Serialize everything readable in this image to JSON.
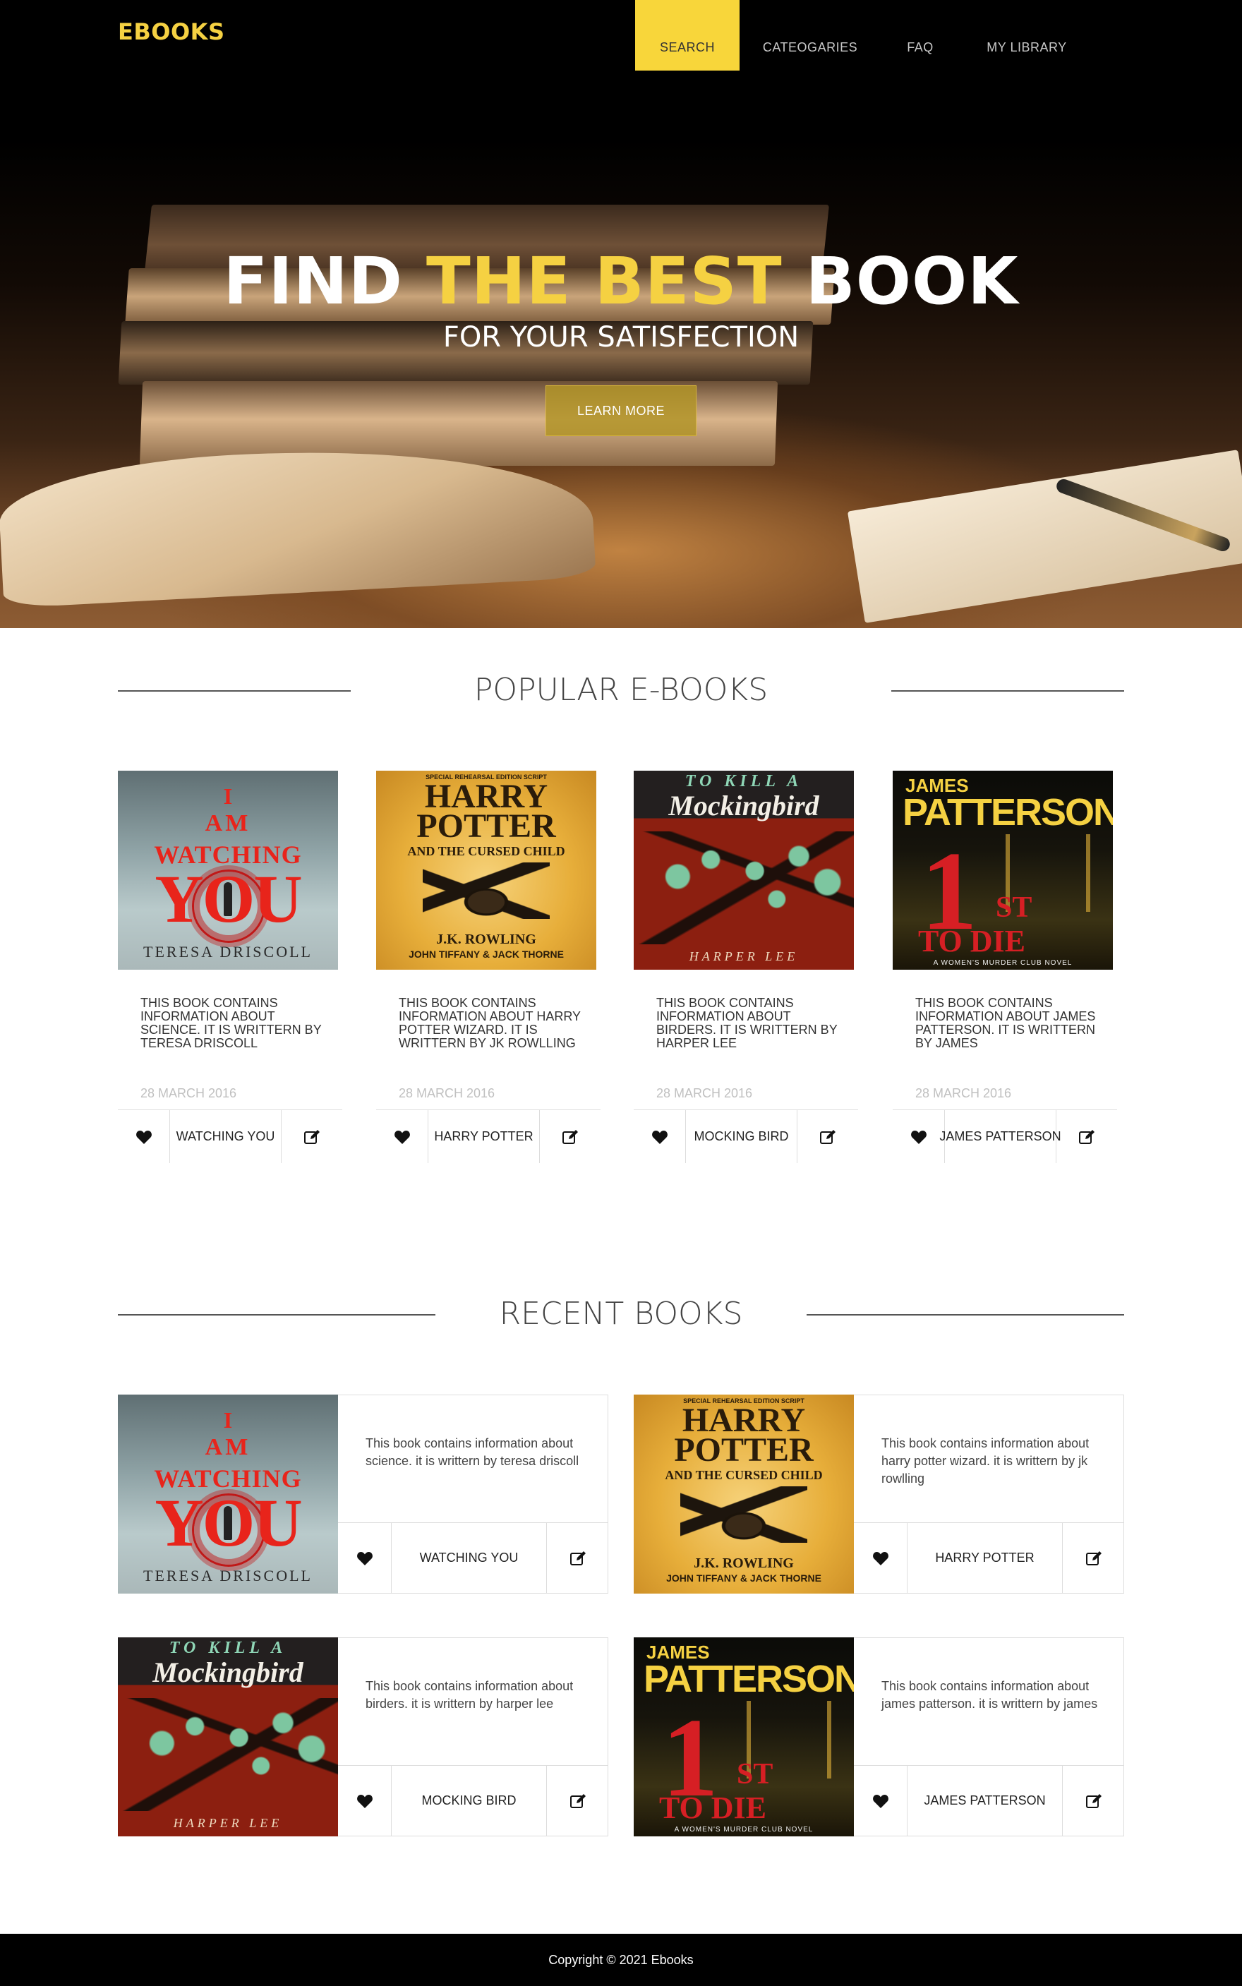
{
  "brand": "EBOOKS",
  "nav": {
    "search": "SEARCH",
    "categories": "CATEOGARIES",
    "faq": "FAQ",
    "library": "MY LIBRARY"
  },
  "hero": {
    "title_pre": "FIND ",
    "title_highlight": "THE BEST",
    "title_post": " BOOK",
    "subtitle": "FOR YOUR SATISFECTION",
    "cta": "LEARN MORE"
  },
  "colors": {
    "accent": "#f8d63a",
    "footer": "#000000"
  },
  "popular": {
    "heading": "POPULAR E-BOOKS",
    "items": [
      {
        "desc": "THIS BOOK CONTAINS INFORMATION ABOUT SCIENCE. IT IS WRITTERN BY TERESA DRISCOLL",
        "date": "28 MARCH 2016",
        "title": "WATCHING YOU"
      },
      {
        "desc": "THIS BOOK CONTAINS INFORMATION ABOUT HARRY POTTER WIZARD. IT IS WRITTERN BY JK ROWLLING",
        "date": "28 MARCH 2016",
        "title": "HARRY POTTER"
      },
      {
        "desc": "THIS BOOK CONTAINS INFORMATION ABOUT BIRDERS. IT IS WRITTERN BY HARPER LEE",
        "date": "28 MARCH 2016",
        "title": "MOCKING BIRD"
      },
      {
        "desc": "THIS BOOK CONTAINS INFORMATION ABOUT JAMES PATTERSON. IT IS WRITTERN BY JAMES",
        "date": "28 MARCH 2016",
        "title": "JAMES PATTERSON"
      }
    ]
  },
  "recent": {
    "heading": "RECENT BOOKS",
    "items": [
      {
        "desc": "This book contains information about science. it is writtern by teresa driscoll",
        "title": "WATCHING YOU"
      },
      {
        "desc": "This book contains information about harry potter wizard. it is writtern by jk rowlling",
        "title": "HARRY POTTER"
      },
      {
        "desc": "This book contains information about birders. it is writtern by harper lee",
        "title": "MOCKING BIRD"
      },
      {
        "desc": "This book contains information about james patterson. it is writtern by james",
        "title": "JAMES PATTERSON"
      }
    ]
  },
  "covers": {
    "watching": {
      "l1": "I",
      "l2": "AM",
      "l3": "WATCHING",
      "l4": "YOU",
      "author": "TERESA DRISCOLL"
    },
    "potter": {
      "top": "SPECIAL REHEARSAL EDITION SCRIPT",
      "l1": "HARRY",
      "l2": "POTTER",
      "l3": "AND THE CURSED CHILD",
      "author": "J.K. ROWLING",
      "sub": "JOHN TIFFANY & JACK THORNE"
    },
    "mockingbird": {
      "l1": "TO KILL A",
      "l2": "Mockingbird",
      "author": "HARPER LEE"
    },
    "patterson": {
      "l1": "JAMES",
      "l2": "PATTERSON",
      "num": "1",
      "st": "ST",
      "l3": "TO DIE",
      "foot": "A WOMEN'S MURDER CLUB NOVEL"
    }
  },
  "icons": {
    "like": "heart-icon",
    "edit": "edit-icon"
  },
  "footer": "Copyright © 2021 Ebooks"
}
